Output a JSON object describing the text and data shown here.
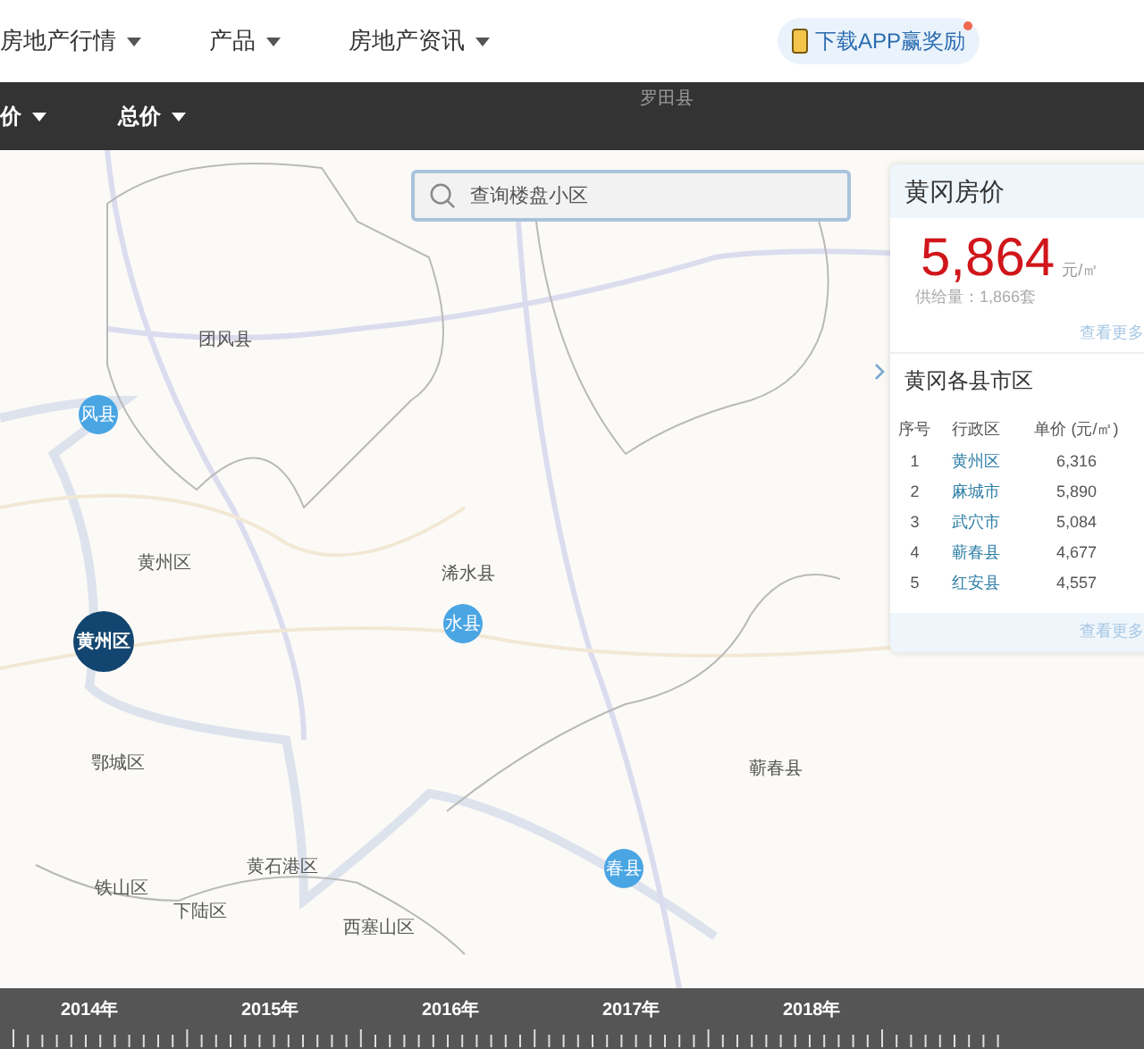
{
  "nav": {
    "items": [
      {
        "label": "房地产行情"
      },
      {
        "label": "产品"
      },
      {
        "label": "房地产资讯"
      }
    ],
    "app_button": {
      "label": "下载APP赢奖励",
      "badge": true
    }
  },
  "filter_bar": {
    "items": [
      {
        "label": "价"
      },
      {
        "label": "总价"
      }
    ],
    "map_label": "罗田县"
  },
  "map": {
    "search": {
      "placeholder": "查询楼盘小区"
    },
    "labels": [
      {
        "text": "团风县"
      },
      {
        "text": "黄州区"
      },
      {
        "text": "浠水县"
      },
      {
        "text": "鄂城区"
      },
      {
        "text": "蕲春县"
      },
      {
        "text": "黄石港区"
      },
      {
        "text": "铁山区"
      },
      {
        "text": "下陆区"
      },
      {
        "text": "西塞山区"
      }
    ],
    "pins": [
      {
        "text": "风县",
        "selected": false
      },
      {
        "text": "黄州区",
        "selected": true
      },
      {
        "text": "水县",
        "selected": false
      },
      {
        "text": "春县",
        "selected": false
      }
    ]
  },
  "panel": {
    "title": "黄冈房价",
    "price": "5,864",
    "unit": "元/㎡",
    "supply": "供给量：1,866套",
    "more": "查看更多",
    "section_title": "黄冈各县市区",
    "columns": [
      "序号",
      "行政区",
      "单价 (元/㎡)"
    ],
    "rows": [
      [
        "1",
        "黄州区",
        "6,316"
      ],
      [
        "2",
        "麻城市",
        "5,890"
      ],
      [
        "3",
        "武穴市",
        "5,084"
      ],
      [
        "4",
        "蕲春县",
        "4,677"
      ],
      [
        "5",
        "红安县",
        "4,557"
      ]
    ],
    "footer": "查看更多"
  },
  "timeline": {
    "years": [
      "2014年",
      "2015年",
      "2016年",
      "2017年",
      "2018年"
    ]
  }
}
